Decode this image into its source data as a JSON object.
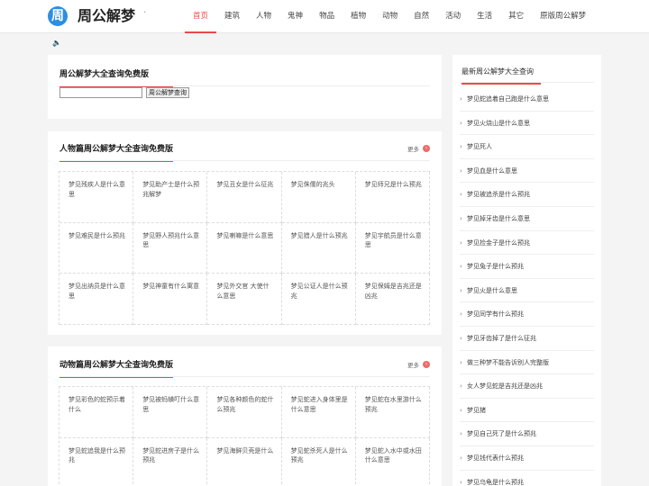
{
  "header": {
    "logo_badge": "周",
    "logo_text": "周公解梦",
    "logo_dot": "·",
    "nav": [
      "首页",
      "建筑",
      "人物",
      "鬼神",
      "物品",
      "植物",
      "动物",
      "自然",
      "活动",
      "生活",
      "其它",
      "原版周公解梦"
    ]
  },
  "speaker_icon": "🔈",
  "search_card": {
    "title": "周公解梦大全查询免费版",
    "input_value": "",
    "button_label": "周公解梦查询"
  },
  "people_card": {
    "title": "人物篇周公解梦大全查询免费版",
    "more_label": "更多",
    "more_icon": "›",
    "items": [
      "梦见残疾人是什么意思",
      "梦见助产士是什么预兆解梦",
      "梦见丑女是什么征兆",
      "梦见侏儒的兆头",
      "梦见师兄是什么预兆",
      "梦见难民是什么预兆",
      "梦见野人预兆什么意思",
      "梦见喇嘛是什么意思",
      "梦见猎人是什么预兆",
      "梦见宇航员是什么意思",
      "梦见出纳员是什么意思",
      "梦见神童有什么寓意",
      "梦见外交官 大使什么意思",
      "梦见公证人是什么预兆",
      "梦见保姆是吉兆还是凶兆"
    ]
  },
  "animal_card": {
    "title": "动物篇周公解梦大全查询免费版",
    "more_label": "更多",
    "more_icon": "›",
    "items": [
      "梦见彩色的蛇预示着什么",
      "梦见被蚂蟥叮什么意思",
      "梦见各种颜色的蛇什么预兆",
      "梦见蛇进入身体里是什么意思",
      "梦见蛇在水里游什么预兆",
      "梦见蛇追我是什么预兆",
      "梦见蛇进房子是什么预兆",
      "梦见海鲜贝壳是什么",
      "梦见蛇杀死人是什么预兆",
      "梦见蛇入水中或水田什么意思"
    ]
  },
  "sidebar": {
    "title": "最新周公解梦大全查询",
    "items": [
      "梦见蛇追着自己跑是什么意思",
      "梦见火烧山是什么意思",
      "梦见死人",
      "梦见血是什么意思",
      "梦见被追杀是什么预兆",
      "梦见掉牙齿是什么意思",
      "梦见捡金子是什么预兆",
      "梦见兔子是什么预兆",
      "梦见火是什么意思",
      "梦见同学有什么预兆",
      "梦见牙齿掉了是什么征兆",
      "做三种梦不能告诉别人完整版",
      "女人梦见蛇是吉兆还是凶兆",
      "梦见猪",
      "梦见自己死了是什么预兆",
      "梦见钱代表什么预兆",
      "梦见乌龟是什么预兆"
    ]
  },
  "colors": {
    "accent": "#e94b4b",
    "logo_blue": "#2d8fe0"
  }
}
